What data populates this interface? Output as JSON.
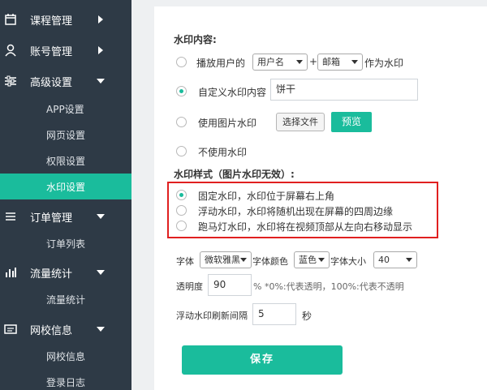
{
  "sidebar": {
    "groups": [
      {
        "label": "课程管理",
        "icon": "calendar-icon"
      },
      {
        "label": "账号管理",
        "icon": "user-icon"
      },
      {
        "label": "高级设置",
        "icon": "sliders-icon"
      },
      {
        "label": "订单管理",
        "icon": "list-icon"
      },
      {
        "label": "流量统计",
        "icon": "bar-chart-icon"
      },
      {
        "label": "网校信息",
        "icon": "card-icon"
      }
    ],
    "items": [
      {
        "label": "APP设置"
      },
      {
        "label": "网页设置"
      },
      {
        "label": "权限设置"
      },
      {
        "label": "水印设置"
      },
      {
        "label": "订单列表"
      },
      {
        "label": "流量统计"
      },
      {
        "label": "网校信息"
      },
      {
        "label": "登录日志"
      }
    ]
  },
  "watermark": {
    "content_title": "水印内容:",
    "option_user_prefix": "播放用户的",
    "select_user_field": "用户名",
    "plus": "+",
    "select_email_field": "邮箱",
    "option_user_suffix": "作为水印",
    "option_custom": "自定义水印内容",
    "custom_value": "饼干",
    "option_image": "使用图片水印",
    "choose_file": "选择文件",
    "preview": "预览",
    "option_none": "不使用水印",
    "style_title": "水印样式（图片水印无效）:",
    "style_fixed": "固定水印，水印位于屏幕右上角",
    "style_float": "浮动水印，水印将随机出现在屏幕的四周边缘",
    "style_marquee": "跑马灯水印，水印将在视频顶部从左向右移动显示",
    "font_label": "字体",
    "font_value": "微软雅黑",
    "font_color_label": "字体颜色",
    "font_color_value": "蓝色",
    "font_size_label": "字体大小",
    "font_size_value": "40",
    "opacity_label": "透明度",
    "opacity_value": "90",
    "opacity_hint": "% *0%:代表透明，100%:代表不透明",
    "refresh_label": "浮动水印刷新间隔",
    "refresh_value": "5",
    "refresh_unit": "秒",
    "save": "保存"
  },
  "colors": {
    "accent": "#1abc9c",
    "sidebar_bg": "#2e3a46",
    "highlight": "#e02020"
  }
}
